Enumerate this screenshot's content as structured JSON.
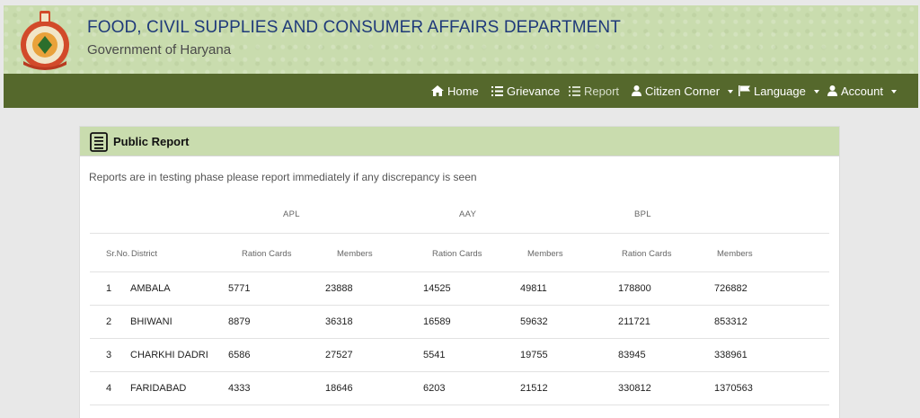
{
  "header": {
    "title": "FOOD, CIVIL SUPPLIES AND CONSUMER AFFAIRS DEPARTMENT",
    "subtitle": "Government of Haryana",
    "bg_color": "#c9dcae",
    "title_color": "#1f3a7a"
  },
  "nav": {
    "bg_color": "#55682c",
    "items": [
      {
        "label": "Home",
        "icon": "home-icon"
      },
      {
        "label": "Grievance",
        "icon": "list-icon"
      },
      {
        "label": "Report",
        "icon": "list-icon"
      },
      {
        "label": "Citizen Corner",
        "icon": "user-icon"
      },
      {
        "label": "Language",
        "icon": "flag-icon"
      },
      {
        "label": "Account",
        "icon": "user-icon"
      }
    ]
  },
  "panel": {
    "title": "Public Report",
    "notice": "Reports are in testing phase please report immediately if any discrepancy is seen"
  },
  "table": {
    "groups": [
      "APL",
      "AAY",
      "BPL"
    ],
    "columns": [
      "Sr.No.",
      "District",
      "Ration Cards",
      "Members",
      "Ration Cards",
      "Members",
      "Ration Cards",
      "Members"
    ],
    "rows": [
      [
        "1",
        "AMBALA",
        "5771",
        "23888",
        "14525",
        "49811",
        "178800",
        "726882"
      ],
      [
        "2",
        "BHIWANI",
        "8879",
        "36318",
        "16589",
        "59632",
        "211721",
        "853312"
      ],
      [
        "3",
        "CHARKHI DADRI",
        "6586",
        "27527",
        "5541",
        "19755",
        "83945",
        "338961"
      ],
      [
        "4",
        "FARIDABAD",
        "4333",
        "18646",
        "6203",
        "21512",
        "330812",
        "1370563"
      ]
    ]
  }
}
